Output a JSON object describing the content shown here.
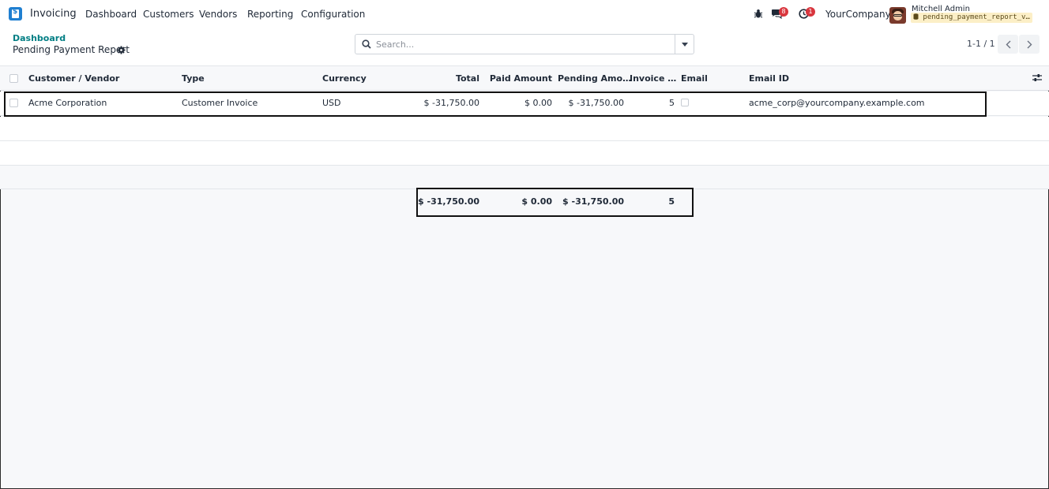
{
  "navbar": {
    "app_name": "Invoicing",
    "menu": [
      "Dashboard",
      "Customers",
      "Vendors",
      "Reporting",
      "Configuration"
    ],
    "messages_count": "8",
    "activities_count": "1",
    "company": "YourCompany",
    "user_name": "Mitchell Admin",
    "database": "pending_payment_report_v…"
  },
  "control_panel": {
    "breadcrumb": "Dashboard",
    "title": "Pending Payment Report",
    "search_placeholder": "Search...",
    "pager": "1-1 / 1"
  },
  "table": {
    "columns": [
      "Customer / Vendor",
      "Type",
      "Currency",
      "Total",
      "Paid Amount",
      "Pending Amo…",
      "Invoice …",
      "Email",
      "Email ID"
    ],
    "rows": [
      {
        "customer": "Acme Corporation",
        "type": "Customer Invoice",
        "currency": "USD",
        "total": "$ -31,750.00",
        "paid": "$ 0.00",
        "pending": "$ -31,750.00",
        "invoice_count": "5",
        "email_checked": false,
        "email_id": "acme_corp@yourcompany.example.com"
      }
    ],
    "totals": {
      "total": "$ -31,750.00",
      "paid": "$ 0.00",
      "pending": "$ -31,750.00",
      "invoice_count": "5"
    }
  },
  "colors": {
    "brand": "#1f7fd1",
    "breadcrumb": "#017e84",
    "badge": "#d9363e"
  }
}
